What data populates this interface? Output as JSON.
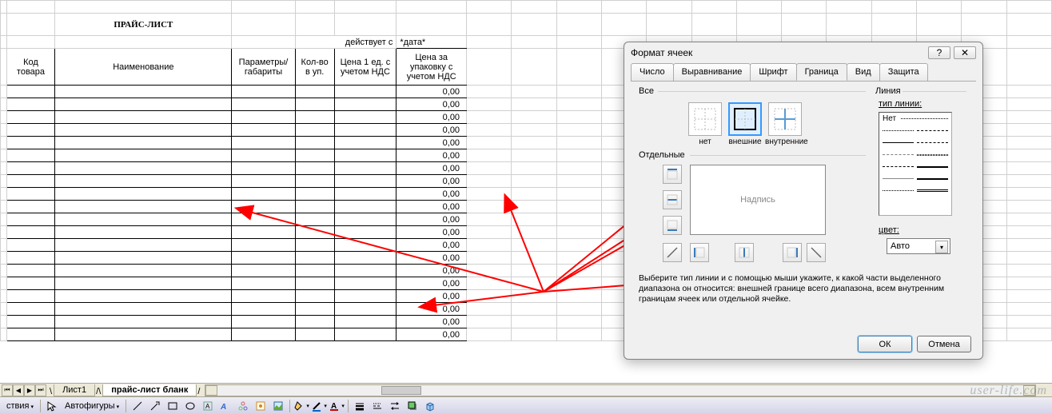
{
  "sheet": {
    "title": "ПРАЙС-ЛИСТ",
    "validFromLabel": "действует с",
    "dateValue": "*дата*",
    "headers": {
      "code": "Код товара",
      "name": "Наименование",
      "params": "Параметры/габариты",
      "qty": "Кол-во в уп.",
      "price1": "Цена 1 ед. с учетом НДС",
      "pricePack": "Цена за упаковку с учетом НДС"
    },
    "priceValue": "0,00",
    "rowCount": 20
  },
  "tabs": {
    "tab1": "Лист1",
    "tab2": "прайс-лист бланк"
  },
  "toolbar": {
    "actions": "ствия",
    "autoshapes": "Автофигуры"
  },
  "dialog": {
    "title": "Формат ячеек",
    "helpBtn": "?",
    "closeBtn": "✕",
    "tabs": {
      "number": "Число",
      "alignment": "Выравнивание",
      "font": "Шрифт",
      "border": "Граница",
      "fill": "Вид",
      "protection": "Защита"
    },
    "groupAll": "Все",
    "groupIndividual": "Отдельные",
    "groupLine": "Линия",
    "typeLabel": "тип линии:",
    "colorLabel": "цвет:",
    "colorValue": "Авто",
    "presets": {
      "none": "нет",
      "outer": "внешние",
      "inner": "внутренние"
    },
    "previewLabel": "Надпись",
    "noneLine": "Нет",
    "help": "Выберите тип линии и с помощью мыши укажите, к какой части выделенного диапазона он относится: внешней границе всего диапазона, всем внутренним границам ячеек или отдельной ячейке.",
    "ok": "ОК",
    "cancel": "Отмена"
  },
  "watermark": "user-life.com"
}
